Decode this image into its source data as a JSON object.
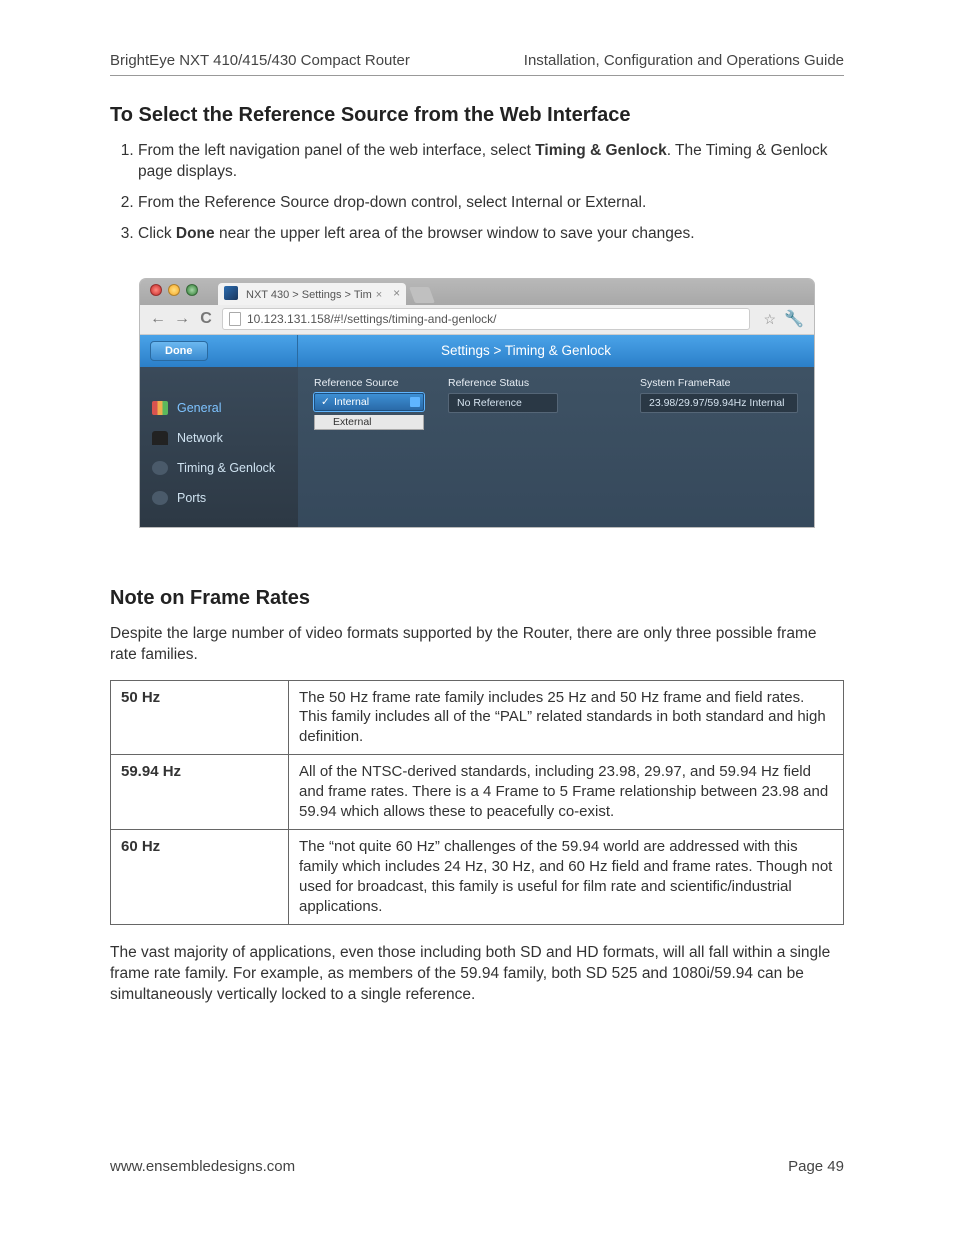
{
  "header": {
    "left": "BrightEye NXT 410/415/430 Compact Router",
    "right": "Installation, Configuration and Operations Guide"
  },
  "section1": {
    "title": "To Select the Reference Source from the Web Interface",
    "step1_pre": "From the left navigation panel of the web interface, select ",
    "step1_bold": "Timing & Genlock",
    "step1_post": ". The Timing & Genlock page displays.",
    "step2": "From the Reference Source drop-down control, select Internal or External.",
    "step3_pre": "Click ",
    "step3_bold": "Done",
    "step3_post": " near the upper left area of the browser window to save your changes."
  },
  "browser": {
    "tab_title": "NXT 430 > Settings > Tim",
    "url": "10.123.131.158/#!/settings/timing-and-genlock/",
    "done_label": "Done",
    "breadcrumb": "Settings > Timing & Genlock",
    "sidebar": {
      "general": "General",
      "network": "Network",
      "timing": "Timing & Genlock",
      "ports": "Ports"
    },
    "panels": {
      "ref_source_label": "Reference Source",
      "ref_source_selected": "Internal",
      "ref_source_option2": "External",
      "ref_status_label": "Reference Status",
      "ref_status_value": "No Reference",
      "framerate_label": "System FrameRate",
      "framerate_value": "23.98/29.97/59.94Hz Internal"
    }
  },
  "section2": {
    "title": "Note on Frame Rates",
    "intro": "Despite the large number of video formats supported by the Router, there are only three possible frame rate families.",
    "rows": [
      {
        "key": "50 Hz",
        "desc": "The 50 Hz frame rate family includes 25 Hz and 50 Hz frame and field rates. This family includes all of the “PAL” related standards in both standard and high definition."
      },
      {
        "key": "59.94 Hz",
        "desc": "All of the NTSC-derived standards, including 23.98, 29.97, and 59.94 Hz field and frame rates. There is a 4 Frame to 5 Frame relationship between 23.98 and 59.94 which allows these to peacefully co-exist."
      },
      {
        "key": "60 Hz",
        "desc": "The “not quite 60 Hz” challenges of the 59.94 world are addressed with this family which includes 24 Hz, 30 Hz, and 60 Hz field and frame rates. Though not used for broadcast, this family is useful for film rate and scientific/industrial applications."
      }
    ],
    "outro": "The vast majority of applications, even those including both SD and HD formats, will all fall within a single frame rate family. For example, as members of the 59.94 family, both SD 525 and 1080i/59.94 can be simultaneously vertically locked to a single reference."
  },
  "footer": {
    "url": "www.ensembledesigns.com",
    "page": "Page 49"
  }
}
